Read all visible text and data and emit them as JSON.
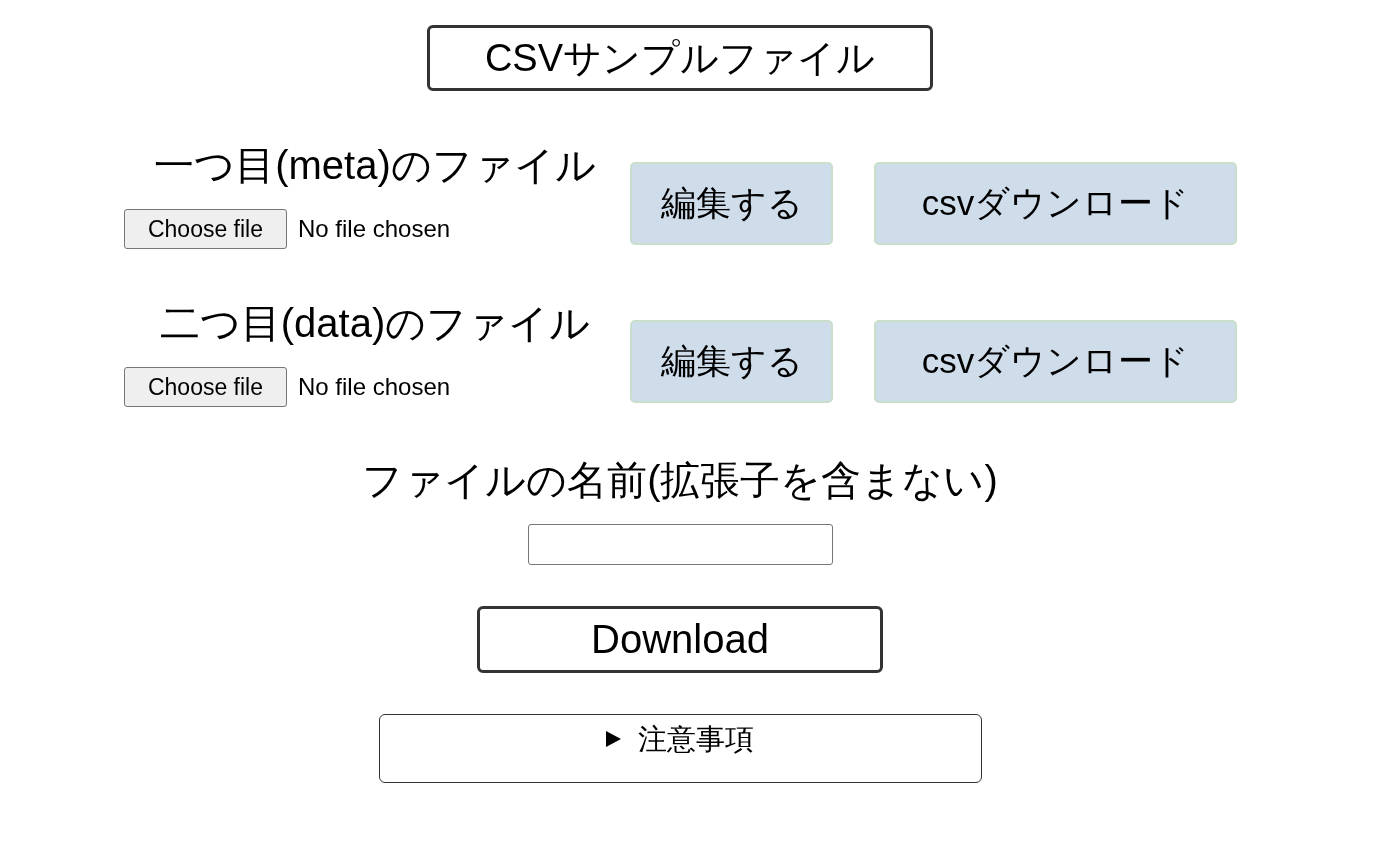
{
  "title": "CSVサンプルファイル",
  "files": [
    {
      "label": "一つ目(meta)のファイル",
      "choose_button": "Choose file",
      "status": "No file chosen",
      "edit_button": "編集する",
      "download_button": "csvダウンロード"
    },
    {
      "label": "二つ目(data)のファイル",
      "choose_button": "Choose file",
      "status": "No file chosen",
      "edit_button": "編集する",
      "download_button": "csvダウンロード"
    }
  ],
  "filename": {
    "label": "ファイルの名前(拡張子を含まない)"
  },
  "download_button": "Download",
  "notes": {
    "title": "注意事項",
    "expanded": false
  }
}
